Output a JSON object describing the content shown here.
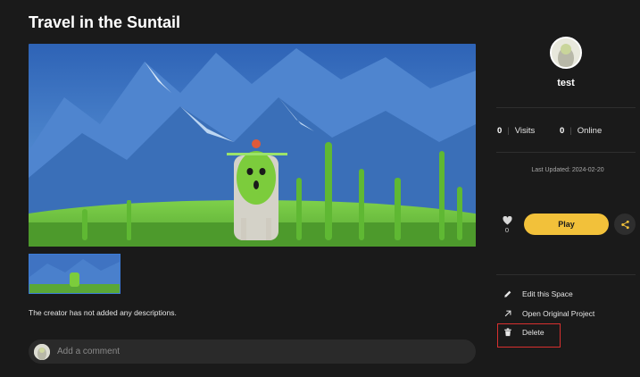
{
  "page": {
    "title": "Travel in the Suntail"
  },
  "main": {
    "description": "The creator has not added any descriptions.",
    "comment": {
      "placeholder": "Add a comment"
    }
  },
  "sidebar": {
    "username": "test",
    "visits_count": "0",
    "visits_label": "Visits",
    "online_count": "0",
    "online_label": "Online",
    "last_updated": "Last Updated: 2024-02-20",
    "like_count": "0",
    "play_label": "Play",
    "menu": {
      "edit_label": "Edit this Space",
      "open_label": "Open Original Project",
      "delete_label": "Delete"
    }
  },
  "colors": {
    "background": "#1a1a1a",
    "accent": "#f2c13a",
    "highlight_border": "#d8302f",
    "thumb_border": "#3b7bd8"
  },
  "icons": [
    "heart-icon",
    "share-icon",
    "pencil-icon",
    "arrow-up-right-icon",
    "trash-icon"
  ]
}
